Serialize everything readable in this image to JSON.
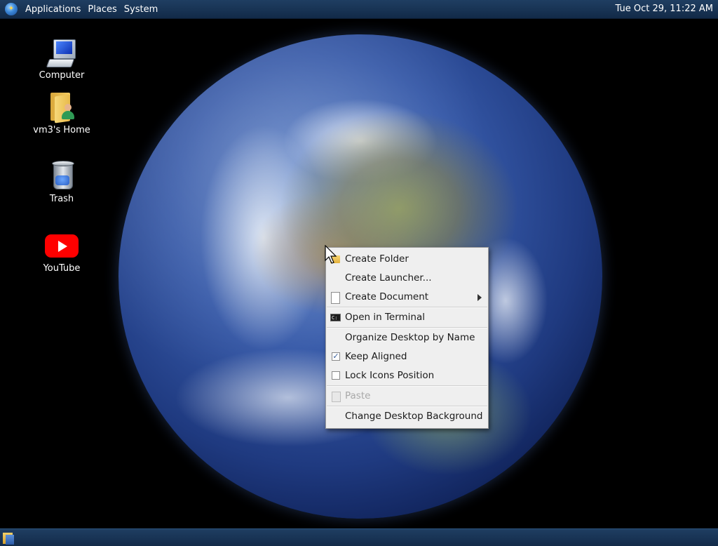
{
  "top_panel": {
    "menus": [
      "Applications",
      "Places",
      "System"
    ],
    "logo_icon": "distro-logo-icon",
    "clock": "Tue Oct 29, 11:22 AM"
  },
  "desktop": {
    "wallpaper": "earth-globe",
    "icons": [
      {
        "label": "Computer",
        "icon": "computer-icon"
      },
      {
        "label": "vm3's Home",
        "icon": "home-folder-icon"
      },
      {
        "label": "Trash",
        "icon": "trash-icon"
      },
      {
        "label": "YouTube",
        "icon": "youtube-icon"
      }
    ]
  },
  "context_menu": {
    "items": [
      {
        "label": "Create Folder",
        "icon": "folder-icon",
        "enabled": true
      },
      {
        "label": "Create Launcher...",
        "enabled": true
      },
      {
        "label": "Create Document",
        "icon": "document-icon",
        "submenu": true,
        "enabled": true
      },
      {
        "label": "Open in Terminal",
        "icon": "terminal-icon",
        "enabled": true
      },
      {
        "label": "Organize Desktop by Name",
        "enabled": true
      },
      {
        "label": "Keep Aligned",
        "checkbox": true,
        "checked": true,
        "enabled": true
      },
      {
        "label": "Lock Icons Position",
        "checkbox": true,
        "checked": false,
        "enabled": true
      },
      {
        "label": "Paste",
        "icon": "paste-icon",
        "enabled": false
      },
      {
        "label": "Change Desktop Background",
        "enabled": true
      }
    ]
  },
  "bottom_panel": {
    "show_desktop_icon": "show-desktop-icon"
  },
  "colors": {
    "panel": "#1a3556",
    "menu_bg": "#efefef",
    "youtube_red": "#ff0000"
  }
}
